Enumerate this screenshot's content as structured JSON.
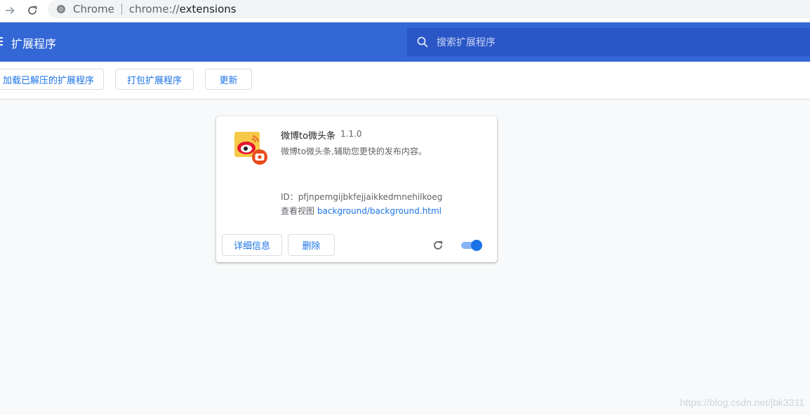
{
  "browser": {
    "site_label": "Chrome",
    "url_scheme": "chrome://",
    "url_path": "extensions"
  },
  "header": {
    "title": "扩展程序",
    "search_placeholder": "搜索扩展程序"
  },
  "dev_toolbar": {
    "load_unpacked": "加载已解压的扩展程序",
    "pack": "打包扩展程序",
    "update": "更新"
  },
  "extension": {
    "name": "微博to微头条",
    "version": "1.1.0",
    "description": "微博to微头条,辅助您更快的发布内容。",
    "id_label": "ID：",
    "id_value": "pfjnpemgijbkfejjaikkedmnehilkoeg",
    "views_label": "查看视图",
    "views_link": "background/background.html",
    "details_button": "详细信息",
    "remove_button": "删除",
    "enabled": true,
    "icon": "weibo-logo-icon"
  },
  "watermark": "https://blog.csdn.net/jbk3311",
  "colors": {
    "header_blue": "#3367d6",
    "search_blue": "#2a56c6",
    "link_blue": "#1a73e8"
  }
}
